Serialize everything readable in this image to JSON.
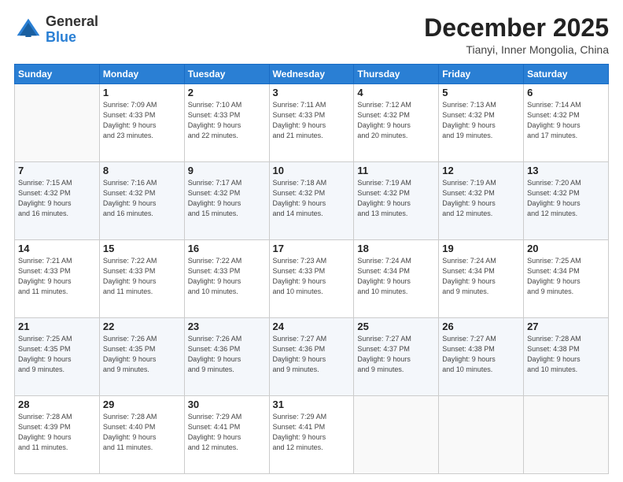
{
  "header": {
    "logo": {
      "general": "General",
      "blue": "Blue"
    },
    "month": "December 2025",
    "location": "Tianyi, Inner Mongolia, China"
  },
  "days_of_week": [
    "Sunday",
    "Monday",
    "Tuesday",
    "Wednesday",
    "Thursday",
    "Friday",
    "Saturday"
  ],
  "weeks": [
    [
      {
        "day": "",
        "info": ""
      },
      {
        "day": "1",
        "info": "Sunrise: 7:09 AM\nSunset: 4:33 PM\nDaylight: 9 hours\nand 23 minutes."
      },
      {
        "day": "2",
        "info": "Sunrise: 7:10 AM\nSunset: 4:33 PM\nDaylight: 9 hours\nand 22 minutes."
      },
      {
        "day": "3",
        "info": "Sunrise: 7:11 AM\nSunset: 4:33 PM\nDaylight: 9 hours\nand 21 minutes."
      },
      {
        "day": "4",
        "info": "Sunrise: 7:12 AM\nSunset: 4:32 PM\nDaylight: 9 hours\nand 20 minutes."
      },
      {
        "day": "5",
        "info": "Sunrise: 7:13 AM\nSunset: 4:32 PM\nDaylight: 9 hours\nand 19 minutes."
      },
      {
        "day": "6",
        "info": "Sunrise: 7:14 AM\nSunset: 4:32 PM\nDaylight: 9 hours\nand 17 minutes."
      }
    ],
    [
      {
        "day": "7",
        "info": "Sunrise: 7:15 AM\nSunset: 4:32 PM\nDaylight: 9 hours\nand 16 minutes."
      },
      {
        "day": "8",
        "info": "Sunrise: 7:16 AM\nSunset: 4:32 PM\nDaylight: 9 hours\nand 16 minutes."
      },
      {
        "day": "9",
        "info": "Sunrise: 7:17 AM\nSunset: 4:32 PM\nDaylight: 9 hours\nand 15 minutes."
      },
      {
        "day": "10",
        "info": "Sunrise: 7:18 AM\nSunset: 4:32 PM\nDaylight: 9 hours\nand 14 minutes."
      },
      {
        "day": "11",
        "info": "Sunrise: 7:19 AM\nSunset: 4:32 PM\nDaylight: 9 hours\nand 13 minutes."
      },
      {
        "day": "12",
        "info": "Sunrise: 7:19 AM\nSunset: 4:32 PM\nDaylight: 9 hours\nand 12 minutes."
      },
      {
        "day": "13",
        "info": "Sunrise: 7:20 AM\nSunset: 4:32 PM\nDaylight: 9 hours\nand 12 minutes."
      }
    ],
    [
      {
        "day": "14",
        "info": "Sunrise: 7:21 AM\nSunset: 4:33 PM\nDaylight: 9 hours\nand 11 minutes."
      },
      {
        "day": "15",
        "info": "Sunrise: 7:22 AM\nSunset: 4:33 PM\nDaylight: 9 hours\nand 11 minutes."
      },
      {
        "day": "16",
        "info": "Sunrise: 7:22 AM\nSunset: 4:33 PM\nDaylight: 9 hours\nand 10 minutes."
      },
      {
        "day": "17",
        "info": "Sunrise: 7:23 AM\nSunset: 4:33 PM\nDaylight: 9 hours\nand 10 minutes."
      },
      {
        "day": "18",
        "info": "Sunrise: 7:24 AM\nSunset: 4:34 PM\nDaylight: 9 hours\nand 10 minutes."
      },
      {
        "day": "19",
        "info": "Sunrise: 7:24 AM\nSunset: 4:34 PM\nDaylight: 9 hours\nand 9 minutes."
      },
      {
        "day": "20",
        "info": "Sunrise: 7:25 AM\nSunset: 4:34 PM\nDaylight: 9 hours\nand 9 minutes."
      }
    ],
    [
      {
        "day": "21",
        "info": "Sunrise: 7:25 AM\nSunset: 4:35 PM\nDaylight: 9 hours\nand 9 minutes."
      },
      {
        "day": "22",
        "info": "Sunrise: 7:26 AM\nSunset: 4:35 PM\nDaylight: 9 hours\nand 9 minutes."
      },
      {
        "day": "23",
        "info": "Sunrise: 7:26 AM\nSunset: 4:36 PM\nDaylight: 9 hours\nand 9 minutes."
      },
      {
        "day": "24",
        "info": "Sunrise: 7:27 AM\nSunset: 4:36 PM\nDaylight: 9 hours\nand 9 minutes."
      },
      {
        "day": "25",
        "info": "Sunrise: 7:27 AM\nSunset: 4:37 PM\nDaylight: 9 hours\nand 9 minutes."
      },
      {
        "day": "26",
        "info": "Sunrise: 7:27 AM\nSunset: 4:38 PM\nDaylight: 9 hours\nand 10 minutes."
      },
      {
        "day": "27",
        "info": "Sunrise: 7:28 AM\nSunset: 4:38 PM\nDaylight: 9 hours\nand 10 minutes."
      }
    ],
    [
      {
        "day": "28",
        "info": "Sunrise: 7:28 AM\nSunset: 4:39 PM\nDaylight: 9 hours\nand 11 minutes."
      },
      {
        "day": "29",
        "info": "Sunrise: 7:28 AM\nSunset: 4:40 PM\nDaylight: 9 hours\nand 11 minutes."
      },
      {
        "day": "30",
        "info": "Sunrise: 7:29 AM\nSunset: 4:41 PM\nDaylight: 9 hours\nand 12 minutes."
      },
      {
        "day": "31",
        "info": "Sunrise: 7:29 AM\nSunset: 4:41 PM\nDaylight: 9 hours\nand 12 minutes."
      },
      {
        "day": "",
        "info": ""
      },
      {
        "day": "",
        "info": ""
      },
      {
        "day": "",
        "info": ""
      }
    ]
  ]
}
